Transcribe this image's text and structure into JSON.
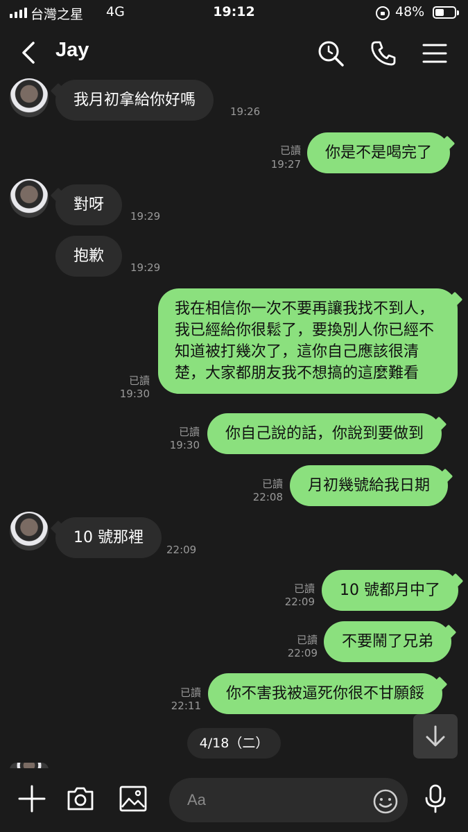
{
  "status_bar": {
    "carrier": "台灣之星",
    "network": "4G",
    "time": "19:12",
    "battery_text": "48%",
    "battery_level": 0.48
  },
  "header": {
    "title": "Jay"
  },
  "messages": [
    {
      "direction": "in",
      "text": "我月初拿給你好嗎",
      "time": "19:26"
    },
    {
      "direction": "out",
      "text": "你是不是喝完了",
      "read": "已讀",
      "time": "19:27"
    },
    {
      "direction": "in",
      "text": "對呀",
      "time": "19:29"
    },
    {
      "direction": "in",
      "text": "抱歉",
      "time": "19:29"
    },
    {
      "direction": "out",
      "text": "我在相信你一次不要再讓我找不到人，我已經給你很鬆了，要換別人你已經不知道被打幾次了，這你自己應該很清楚，大家都朋友我不想搞的這麼難看",
      "read": "已讀",
      "time": "19:30"
    },
    {
      "direction": "out",
      "text": "你自己說的話，你說到要做到",
      "read": "已讀",
      "time": "19:30"
    },
    {
      "direction": "out",
      "text": "月初幾號給我日期",
      "read": "已讀",
      "time": "22:08"
    },
    {
      "direction": "in",
      "text": "10 號那裡",
      "time": "22:09"
    },
    {
      "direction": "out",
      "text": "10 號都月中了",
      "read": "已讀",
      "time": "22:09"
    },
    {
      "direction": "out",
      "text": "不要鬧了兄弟",
      "read": "已讀",
      "time": "22:09"
    },
    {
      "direction": "out",
      "text": "你不害我被逼死你很不甘願餒",
      "read": "已讀",
      "time": "22:11"
    }
  ],
  "date_separator": "4/18（二）",
  "input": {
    "placeholder": "Aa"
  },
  "icons": {
    "back": "chevron-left-icon",
    "search": "search-icon",
    "call": "phone-icon",
    "menu": "hamburger-menu-icon",
    "add": "plus-icon",
    "camera": "camera-icon",
    "image": "image-icon",
    "emoji": "emoji-icon",
    "mic": "microphone-icon",
    "scroll_down": "arrow-down-icon"
  },
  "colors": {
    "background": "#1b1b1b",
    "incoming_bubble": "#2c2c2c",
    "outgoing_bubble": "#8be07e"
  }
}
